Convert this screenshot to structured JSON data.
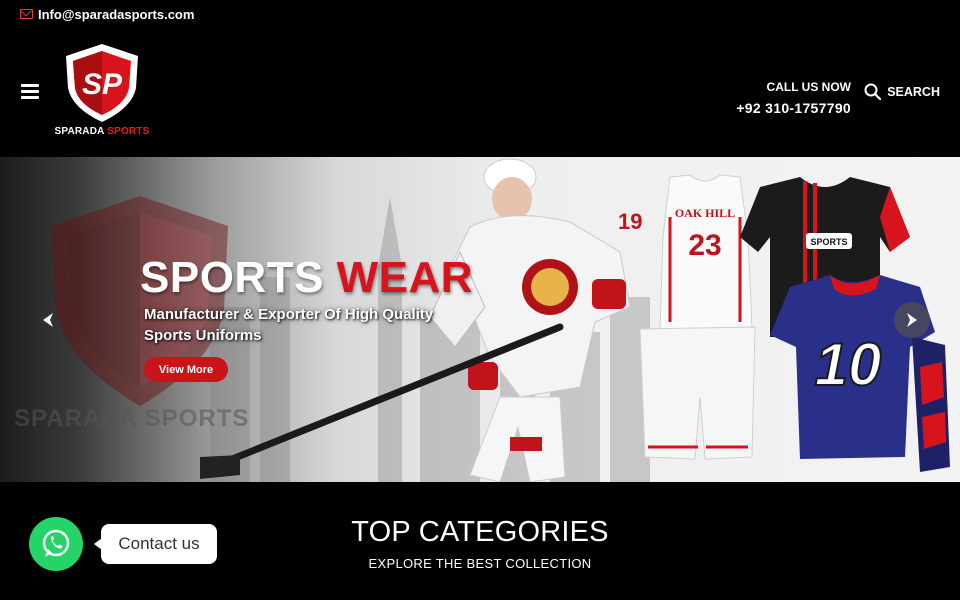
{
  "topbar": {
    "email": "Info@sparadasports.com",
    "icon": "envelope-icon"
  },
  "logo": {
    "monogram": "SP",
    "word1": "SPARADA",
    "word2": "SPORTS"
  },
  "header": {
    "call_label": "CALL US NOW",
    "phone": "+92 310-1757790",
    "search_label": "SEARCH"
  },
  "hero": {
    "title_white": "SPORTS",
    "title_red": "WEAR",
    "subtitle": "Manufacturer & Exporter Of High Quality Sports Uniforms",
    "button": "View More",
    "ghost_text": "SPARADA SPORTS",
    "jersey_hockey_number": "19",
    "jersey_basketball_team": "OAK HILL",
    "jersey_basketball_number": "23",
    "jersey_football_number": "10",
    "jersey_soccer_badge": "SPORTS"
  },
  "categories": {
    "title": "TOP CATEGORIES",
    "subtitle": "EXPLORE THE BEST COLLECTION"
  },
  "whatsapp": {
    "label": "Contact us"
  },
  "colors": {
    "accent": "#e0201e",
    "whatsapp": "#25d366",
    "background": "#000000"
  }
}
